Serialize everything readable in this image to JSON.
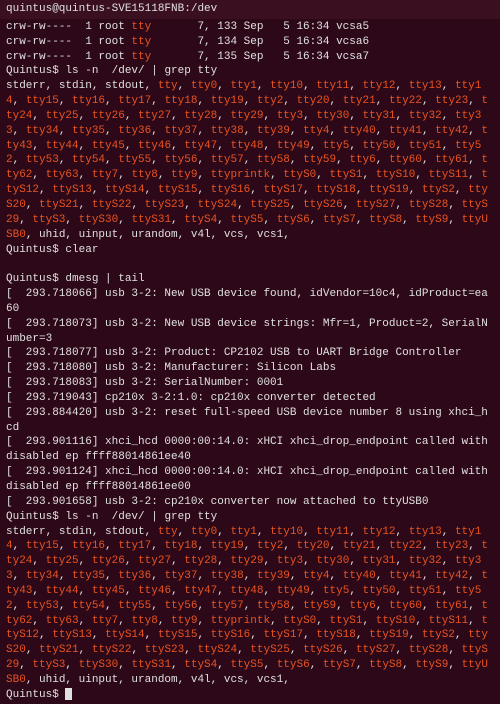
{
  "title_user": "quintus@quintus-SVE15118FNB",
  "title_path": "/dev",
  "ls_header": [
    {
      "perm": "crw-rw----",
      "n": "1",
      "owner": "root",
      "grp": "tty",
      "maj": "7,",
      "min": "133",
      "date": "Sep   5 16:34",
      "name": "vcsa5"
    },
    {
      "perm": "crw-rw----",
      "n": "1",
      "owner": "root",
      "grp": "tty",
      "maj": "7,",
      "min": "134",
      "date": "Sep   5 16:34",
      "name": "vcsa6"
    },
    {
      "perm": "crw-rw----",
      "n": "1",
      "owner": "root",
      "grp": "tty",
      "maj": "7,",
      "min": "135",
      "date": "Sep   5 16:34",
      "name": "vcsa7"
    }
  ],
  "prompt_user": "Quintus$",
  "cmd1": "ls -n  /dev/ | grep tty",
  "cmd2": "clear",
  "cmd3": "dmesg | tail",
  "cmd4": "ls -n  /dev/ | grep tty",
  "pre_tokens": [
    "stderr, ",
    "stdin, ",
    "stdout, "
  ],
  "tty_tokens": [
    "tty",
    "tty0",
    "tty1",
    "tty10",
    "tty11",
    "tty12",
    "tty13",
    "tty14",
    "tty15",
    "tty16",
    "tty17",
    "tty18",
    "tty19",
    "tty2",
    "tty20",
    "tty21",
    "tty22",
    "tty23",
    "tty24",
    "tty25",
    "tty26",
    "tty27",
    "tty28",
    "tty29",
    "tty3",
    "tty30",
    "tty31",
    "tty32",
    "tty33",
    "tty34",
    "tty35",
    "tty36",
    "tty37",
    "tty38",
    "tty39",
    "tty4",
    "tty40",
    "tty41",
    "tty42",
    "tty43",
    "tty44",
    "tty45",
    "tty46",
    "tty47",
    "tty48",
    "tty49",
    "tty5",
    "tty50",
    "tty51",
    "tty52",
    "tty53",
    "tty54",
    "tty55",
    "tty56",
    "tty57",
    "tty58",
    "tty59",
    "tty6",
    "tty60",
    "tty61",
    "tty62",
    "tty63",
    "tty7",
    "tty8",
    "tty9",
    "ttyprintk",
    "ttyS0",
    "ttyS1",
    "ttyS10",
    "ttyS11",
    "ttyS12",
    "ttyS13",
    "ttyS14",
    "ttyS15",
    "ttyS16",
    "ttyS17",
    "ttyS18",
    "ttyS19",
    "ttyS2",
    "ttyS20",
    "ttyS21",
    "ttyS22",
    "ttyS23",
    "ttyS24",
    "ttyS25",
    "ttyS26",
    "ttyS27",
    "ttyS28",
    "ttyS29",
    "ttyS3",
    "ttyS30",
    "ttyS31",
    "ttyS4",
    "ttyS5",
    "ttyS6",
    "ttyS7",
    "ttyS8",
    "ttyS9",
    "ttyUSB0"
  ],
  "post_tokens": [
    ", uhid, uinput, urandom, v4l, vcs, vcs1,"
  ],
  "dmesg": [
    {
      "ts": "293.718066",
      "txt": "usb 3-2: New USB device found, idVendor=10c4, idProduct=ea60"
    },
    {
      "ts": "293.718073",
      "txt": "usb 3-2: New USB device strings: Mfr=1, Product=2, SerialNumber=3"
    },
    {
      "ts": "293.718077",
      "txt": "usb 3-2: Product: CP2102 USB to UART Bridge Controller"
    },
    {
      "ts": "293.718080",
      "txt": "usb 3-2: Manufacturer: Silicon Labs"
    },
    {
      "ts": "293.718083",
      "txt": "usb 3-2: SerialNumber: 0001"
    },
    {
      "ts": "293.719043",
      "txt": "cp210x 3-2:1.0: cp210x converter detected"
    },
    {
      "ts": "293.884420",
      "txt": "usb 3-2: reset full-speed USB device number 8 using xhci_hcd"
    },
    {
      "ts": "293.901116",
      "txt": "xhci_hcd 0000:00:14.0: xHCI xhci_drop_endpoint called with disabled ep ffff88014861ee40"
    },
    {
      "ts": "293.901124",
      "txt": "xhci_hcd 0000:00:14.0: xHCI xhci_drop_endpoint called with disabled ep ffff88014861ee00"
    },
    {
      "ts": "293.901658",
      "txt": "usb 3-2: cp210x converter now attached to ttyUSB0"
    }
  ]
}
